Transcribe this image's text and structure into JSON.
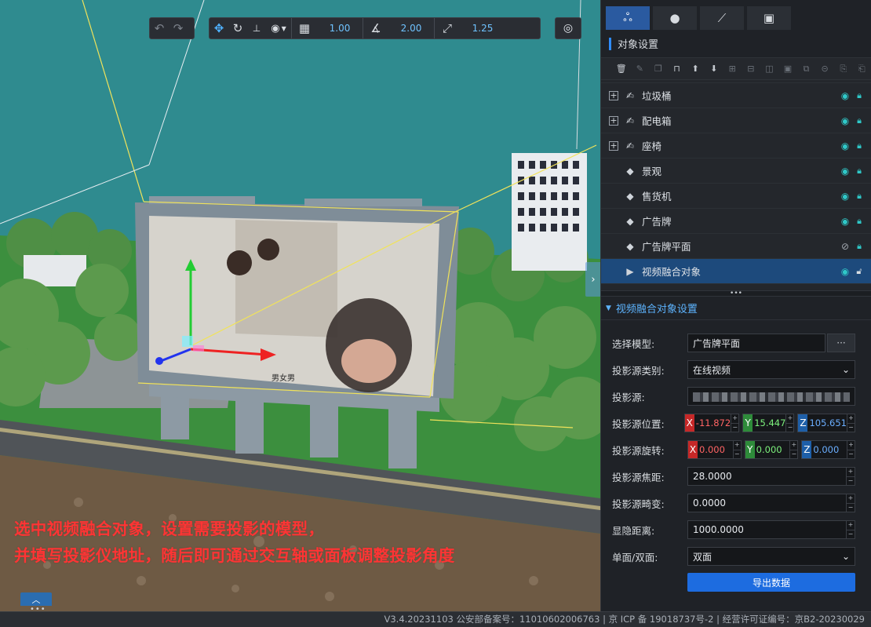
{
  "viewport": {
    "toolbar": {
      "snap_move_value": "1.00",
      "snap_rotate_value": "2.00",
      "snap_scale_value": "1.25"
    },
    "billboard_caption": "男女男",
    "caption_lines": [
      "选中视频融合对象，设置需要投影的模型，",
      "并填写投影仪地址，随后即可通过交互轴或面板调整投影角度"
    ],
    "collapse_icon": "chevron-up-icon"
  },
  "statusbar": {
    "text": "V3.4.20231103 公安部备案号：11010602006763 | 京 ICP 备 19018737号-2 | 经营许可证编号：京B2-20230029"
  },
  "panel": {
    "tabs": [
      "objects-tab",
      "light-tab",
      "effects-tab",
      "image-tab"
    ],
    "section_title": "对象设置",
    "tree": [
      {
        "label": "垃圾桶",
        "expandable": true,
        "icon": "brush-icon",
        "visible": true
      },
      {
        "label": "配电箱",
        "expandable": true,
        "icon": "brush-icon",
        "visible": true
      },
      {
        "label": "座椅",
        "expandable": true,
        "icon": "brush-icon",
        "visible": true
      },
      {
        "label": "景观",
        "expandable": false,
        "icon": "cube-icon",
        "visible": true
      },
      {
        "label": "售货机",
        "expandable": false,
        "icon": "cube-icon",
        "visible": true
      },
      {
        "label": "广告牌",
        "expandable": false,
        "icon": "cube-icon",
        "visible": true
      },
      {
        "label": "广告牌平面",
        "expandable": false,
        "icon": "cube-icon",
        "visible": false
      },
      {
        "label": "视频融合对象",
        "expandable": false,
        "icon": "video-icon",
        "visible": true,
        "selected": true
      }
    ],
    "form_title": "视频融合对象设置",
    "form": {
      "model_label": "选择模型:",
      "model_value": "广告牌平面",
      "more_label": "···",
      "source_type_label": "投影源类别:",
      "source_type_value": "在线视频",
      "source_label": "投影源:",
      "position_label": "投影源位置:",
      "position": {
        "x": "-11.872",
        "y": "15.447",
        "z": "105.651"
      },
      "rotation_label": "投影源旋转:",
      "rotation": {
        "x": "0.000",
        "y": "0.000",
        "z": "0.000"
      },
      "focal_label": "投影源焦距:",
      "focal_value": "28.0000",
      "distortion_label": "投影源畸变:",
      "distortion_value": "0.0000",
      "hide_distance_label": "显隐距离:",
      "hide_distance_value": "1000.0000",
      "sides_label": "单面/双面:",
      "sides_value": "双面",
      "export_label": "导出数据"
    }
  }
}
